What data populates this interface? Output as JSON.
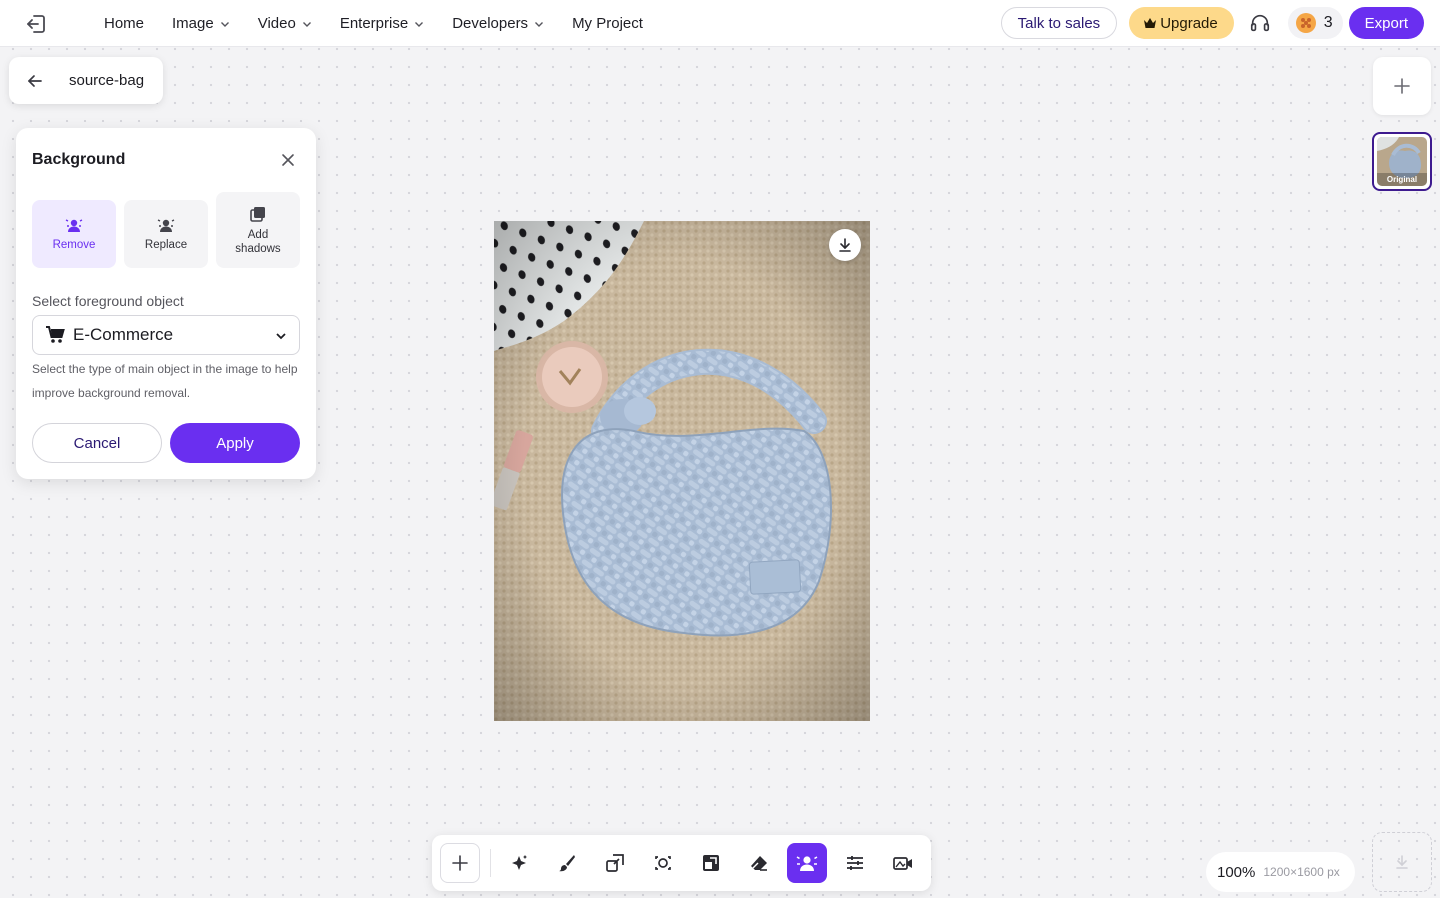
{
  "topbar": {
    "nav": [
      {
        "label": "Home",
        "has_menu": false
      },
      {
        "label": "Image",
        "has_menu": true
      },
      {
        "label": "Video",
        "has_menu": true
      },
      {
        "label": "Enterprise",
        "has_menu": true
      },
      {
        "label": "Developers",
        "has_menu": true
      },
      {
        "label": "My Project",
        "has_menu": false
      }
    ],
    "talk_to_sales": "Talk to sales",
    "upgrade": "Upgrade",
    "credits": "3",
    "export": "Export"
  },
  "file": {
    "name": "source-bag"
  },
  "panel": {
    "title": "Background",
    "modes": [
      {
        "label": "Remove",
        "active": true,
        "icon": "remove-bg-icon"
      },
      {
        "label": "Replace",
        "active": false,
        "icon": "replace-bg-icon"
      },
      {
        "label": "Add shadows",
        "active": false,
        "icon": "shadow-icon"
      }
    ],
    "select_label": "Select foreground object",
    "select_value": "E-Commerce",
    "helper": "Select the type of main object in the image to help improve background removal.",
    "cancel": "Cancel",
    "apply": "Apply"
  },
  "rail": {
    "thumb_label": "Original"
  },
  "toolbar": {
    "tools": [
      "add-icon",
      "magic-icon",
      "brush-icon",
      "resize-icon",
      "retouch-icon",
      "expand-icon",
      "eraser-icon",
      "background-icon",
      "adjust-icon",
      "video-icon"
    ],
    "active_tool": "background-icon"
  },
  "zoom": {
    "percent": "100%",
    "dimensions": "1200×1600 px"
  },
  "colors": {
    "accent": "#6a2ff0",
    "upgrade_bg": "#fdd98a",
    "active_mode_bg": "#efeaff"
  }
}
